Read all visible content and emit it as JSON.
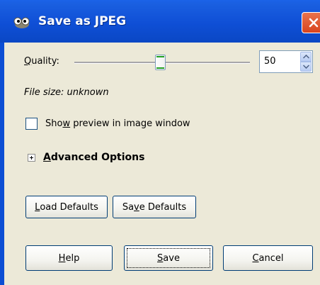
{
  "window": {
    "title": "Save as JPEG",
    "icon": "gimp-icon",
    "close_icon": "close-icon"
  },
  "quality": {
    "label_mnemonic": "Q",
    "label_rest": "uality:",
    "value": "50",
    "slider_fraction": 0.5
  },
  "file_size": "File size: unknown",
  "preview": {
    "label_before": "Sho",
    "label_mnemonic": "w",
    "label_after": " preview in image window",
    "checked": false
  },
  "advanced": {
    "label_mnemonic": "A",
    "label_rest": "dvanced Options",
    "expanded": false
  },
  "buttons": {
    "load_defaults": {
      "mnemonic": "L",
      "rest": "oad Defaults"
    },
    "save_defaults": {
      "before": "Sa",
      "mnemonic": "v",
      "after": "e Defaults"
    },
    "help": {
      "mnemonic": "H",
      "rest": "elp"
    },
    "save": {
      "mnemonic": "S",
      "rest": "ave"
    },
    "cancel": {
      "mnemonic": "C",
      "rest": "ancel"
    }
  },
  "colors": {
    "titlebar": "#0f4fd6",
    "dialog_bg": "#ece9d8",
    "close_button": "#d9441e",
    "slider_thumb_accent": "#21a121"
  }
}
